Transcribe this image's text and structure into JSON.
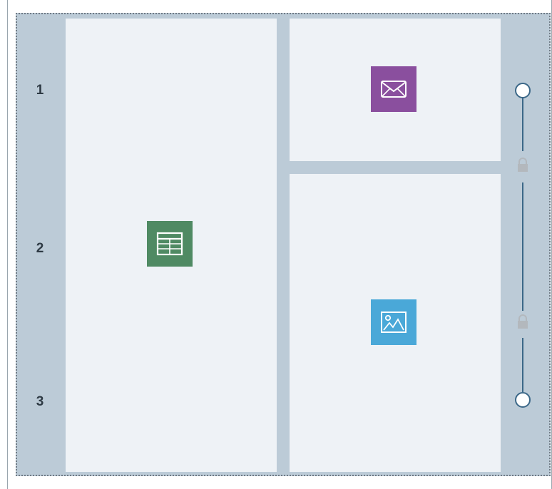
{
  "layout_editor": {
    "row_labels": [
      "1",
      "2",
      "3"
    ],
    "panels": [
      {
        "id": "left-panel",
        "widget": "table-icon",
        "color": "#4f8a63"
      },
      {
        "id": "top-right-panel",
        "widget": "mail-icon",
        "color": "#8a4f9e"
      },
      {
        "id": "bottom-right-panel",
        "widget": "image-icon",
        "color": "#4aa8d8"
      }
    ],
    "colors": {
      "canvas_background": "#bccbd7",
      "panel_background": "#eef2f6",
      "rail_accent": "#3c6888",
      "lock_gray": "#b3b8bd"
    },
    "rail": {
      "handles": [
        "top-handle",
        "bottom-handle"
      ],
      "locks": [
        "lock-icon",
        "lock-icon"
      ]
    }
  }
}
